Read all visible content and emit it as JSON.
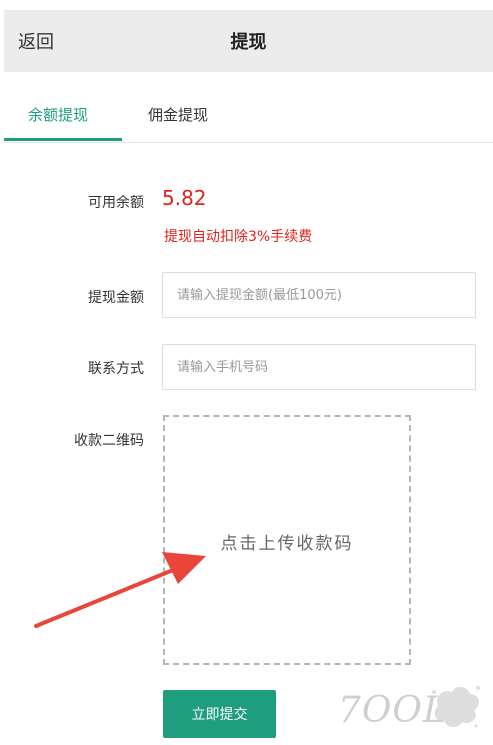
{
  "header": {
    "back_label": "返回",
    "title": "提现"
  },
  "tabs": [
    {
      "label": "余额提现",
      "active": true
    },
    {
      "label": "佣金提现",
      "active": false
    }
  ],
  "form": {
    "balance_label": "可用余额",
    "balance_value": "5.82",
    "fee_note": "提现自动扣除3%手续费",
    "amount_label": "提现金额",
    "amount_placeholder": "请输入提现金额(最低100元)",
    "contact_label": "联系方式",
    "contact_placeholder": "请输入手机号码",
    "qrcode_label": "收款二维码",
    "upload_text": "点击上传收款码",
    "submit_label": "立即提交"
  },
  "watermark": {
    "text": "7OOLS"
  },
  "colors": {
    "accent": "#1e9e7e",
    "alert": "#e2231a",
    "arrow": "#e8463a"
  }
}
